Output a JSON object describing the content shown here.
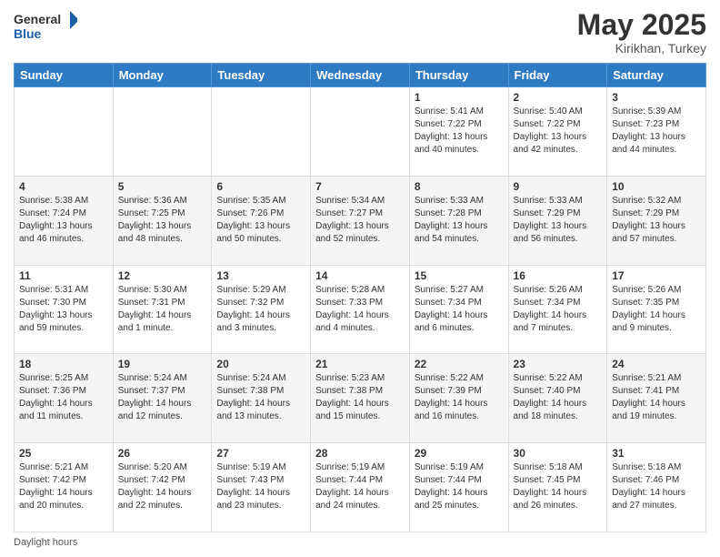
{
  "header": {
    "logo_general": "General",
    "logo_blue": "Blue",
    "title": "May 2025",
    "subtitle": "Kirikhan, Turkey"
  },
  "calendar": {
    "days": [
      "Sunday",
      "Monday",
      "Tuesday",
      "Wednesday",
      "Thursday",
      "Friday",
      "Saturday"
    ],
    "weeks": [
      [
        {
          "day": "",
          "info": ""
        },
        {
          "day": "",
          "info": ""
        },
        {
          "day": "",
          "info": ""
        },
        {
          "day": "",
          "info": ""
        },
        {
          "day": "1",
          "info": "Sunrise: 5:41 AM\nSunset: 7:22 PM\nDaylight: 13 hours\nand 40 minutes."
        },
        {
          "day": "2",
          "info": "Sunrise: 5:40 AM\nSunset: 7:22 PM\nDaylight: 13 hours\nand 42 minutes."
        },
        {
          "day": "3",
          "info": "Sunrise: 5:39 AM\nSunset: 7:23 PM\nDaylight: 13 hours\nand 44 minutes."
        }
      ],
      [
        {
          "day": "4",
          "info": "Sunrise: 5:38 AM\nSunset: 7:24 PM\nDaylight: 13 hours\nand 46 minutes."
        },
        {
          "day": "5",
          "info": "Sunrise: 5:36 AM\nSunset: 7:25 PM\nDaylight: 13 hours\nand 48 minutes."
        },
        {
          "day": "6",
          "info": "Sunrise: 5:35 AM\nSunset: 7:26 PM\nDaylight: 13 hours\nand 50 minutes."
        },
        {
          "day": "7",
          "info": "Sunrise: 5:34 AM\nSunset: 7:27 PM\nDaylight: 13 hours\nand 52 minutes."
        },
        {
          "day": "8",
          "info": "Sunrise: 5:33 AM\nSunset: 7:28 PM\nDaylight: 13 hours\nand 54 minutes."
        },
        {
          "day": "9",
          "info": "Sunrise: 5:33 AM\nSunset: 7:29 PM\nDaylight: 13 hours\nand 56 minutes."
        },
        {
          "day": "10",
          "info": "Sunrise: 5:32 AM\nSunset: 7:29 PM\nDaylight: 13 hours\nand 57 minutes."
        }
      ],
      [
        {
          "day": "11",
          "info": "Sunrise: 5:31 AM\nSunset: 7:30 PM\nDaylight: 13 hours\nand 59 minutes."
        },
        {
          "day": "12",
          "info": "Sunrise: 5:30 AM\nSunset: 7:31 PM\nDaylight: 14 hours\nand 1 minute."
        },
        {
          "day": "13",
          "info": "Sunrise: 5:29 AM\nSunset: 7:32 PM\nDaylight: 14 hours\nand 3 minutes."
        },
        {
          "day": "14",
          "info": "Sunrise: 5:28 AM\nSunset: 7:33 PM\nDaylight: 14 hours\nand 4 minutes."
        },
        {
          "day": "15",
          "info": "Sunrise: 5:27 AM\nSunset: 7:34 PM\nDaylight: 14 hours\nand 6 minutes."
        },
        {
          "day": "16",
          "info": "Sunrise: 5:26 AM\nSunset: 7:34 PM\nDaylight: 14 hours\nand 7 minutes."
        },
        {
          "day": "17",
          "info": "Sunrise: 5:26 AM\nSunset: 7:35 PM\nDaylight: 14 hours\nand 9 minutes."
        }
      ],
      [
        {
          "day": "18",
          "info": "Sunrise: 5:25 AM\nSunset: 7:36 PM\nDaylight: 14 hours\nand 11 minutes."
        },
        {
          "day": "19",
          "info": "Sunrise: 5:24 AM\nSunset: 7:37 PM\nDaylight: 14 hours\nand 12 minutes."
        },
        {
          "day": "20",
          "info": "Sunrise: 5:24 AM\nSunset: 7:38 PM\nDaylight: 14 hours\nand 13 minutes."
        },
        {
          "day": "21",
          "info": "Sunrise: 5:23 AM\nSunset: 7:38 PM\nDaylight: 14 hours\nand 15 minutes."
        },
        {
          "day": "22",
          "info": "Sunrise: 5:22 AM\nSunset: 7:39 PM\nDaylight: 14 hours\nand 16 minutes."
        },
        {
          "day": "23",
          "info": "Sunrise: 5:22 AM\nSunset: 7:40 PM\nDaylight: 14 hours\nand 18 minutes."
        },
        {
          "day": "24",
          "info": "Sunrise: 5:21 AM\nSunset: 7:41 PM\nDaylight: 14 hours\nand 19 minutes."
        }
      ],
      [
        {
          "day": "25",
          "info": "Sunrise: 5:21 AM\nSunset: 7:42 PM\nDaylight: 14 hours\nand 20 minutes."
        },
        {
          "day": "26",
          "info": "Sunrise: 5:20 AM\nSunset: 7:42 PM\nDaylight: 14 hours\nand 22 minutes."
        },
        {
          "day": "27",
          "info": "Sunrise: 5:19 AM\nSunset: 7:43 PM\nDaylight: 14 hours\nand 23 minutes."
        },
        {
          "day": "28",
          "info": "Sunrise: 5:19 AM\nSunset: 7:44 PM\nDaylight: 14 hours\nand 24 minutes."
        },
        {
          "day": "29",
          "info": "Sunrise: 5:19 AM\nSunset: 7:44 PM\nDaylight: 14 hours\nand 25 minutes."
        },
        {
          "day": "30",
          "info": "Sunrise: 5:18 AM\nSunset: 7:45 PM\nDaylight: 14 hours\nand 26 minutes."
        },
        {
          "day": "31",
          "info": "Sunrise: 5:18 AM\nSunset: 7:46 PM\nDaylight: 14 hours\nand 27 minutes."
        }
      ]
    ]
  },
  "footer": {
    "note": "Daylight hours"
  }
}
